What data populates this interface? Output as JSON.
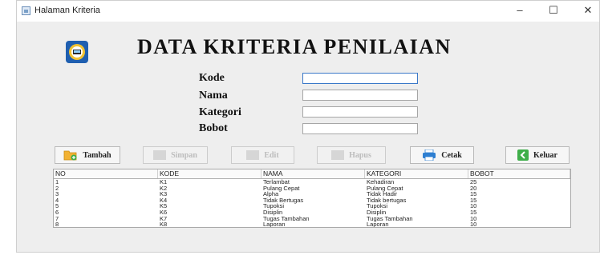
{
  "window": {
    "title": "Halaman Kriteria",
    "minimize": "–",
    "maximize": "☐",
    "close": "✕"
  },
  "header": {
    "title": "DATA KRITERIA PENILAIAN"
  },
  "form": {
    "kode_label": "Kode",
    "kode_value": "",
    "nama_label": "Nama",
    "nama_value": "",
    "kategori_label": "Kategori",
    "kategori_value": "",
    "bobot_label": "Bobot",
    "bobot_value": ""
  },
  "toolbar": {
    "tambah": "Tambah",
    "simpan": "Simpan",
    "edit": "Edit",
    "hapus": "Hapus",
    "cetak": "Cetak",
    "keluar": "Keluar"
  },
  "table": {
    "columns": [
      "NO",
      "KODE",
      "NAMA",
      "KATEGORI",
      "BOBOT"
    ],
    "rows": [
      [
        "1",
        "K1",
        "Terlambat",
        "Kehadiran",
        "25"
      ],
      [
        "2",
        "K2",
        "Pulang Cepat",
        "Pulang Cepat",
        "20"
      ],
      [
        "3",
        "K3",
        "Alpha",
        "Tidak Hadir",
        "15"
      ],
      [
        "4",
        "K4",
        "Tidak Bertugas",
        "Tidak bertugas",
        "15"
      ],
      [
        "5",
        "K5",
        "Tupoksi",
        "Tupoksi",
        "10"
      ],
      [
        "6",
        "K6",
        "Disiplin",
        "Disiplin",
        "15"
      ],
      [
        "7",
        "K7",
        "Tugas Tambahan",
        "Tugas Tambahan",
        "10"
      ],
      [
        "8",
        "K8",
        "Laporan",
        "Laporan",
        "10"
      ]
    ]
  },
  "colors": {
    "accent": "#3a78c8",
    "logo_bg": "#1f5fb0",
    "logo_ring": "#f1c232",
    "cetak_icon": "#2e7fd1",
    "keluar_icon": "#3fae4a"
  },
  "icons": {
    "app": "window-icon",
    "logo": "emblem-icon",
    "tambah": "folder-add-icon",
    "cetak": "printer-icon",
    "keluar": "exit-icon"
  }
}
